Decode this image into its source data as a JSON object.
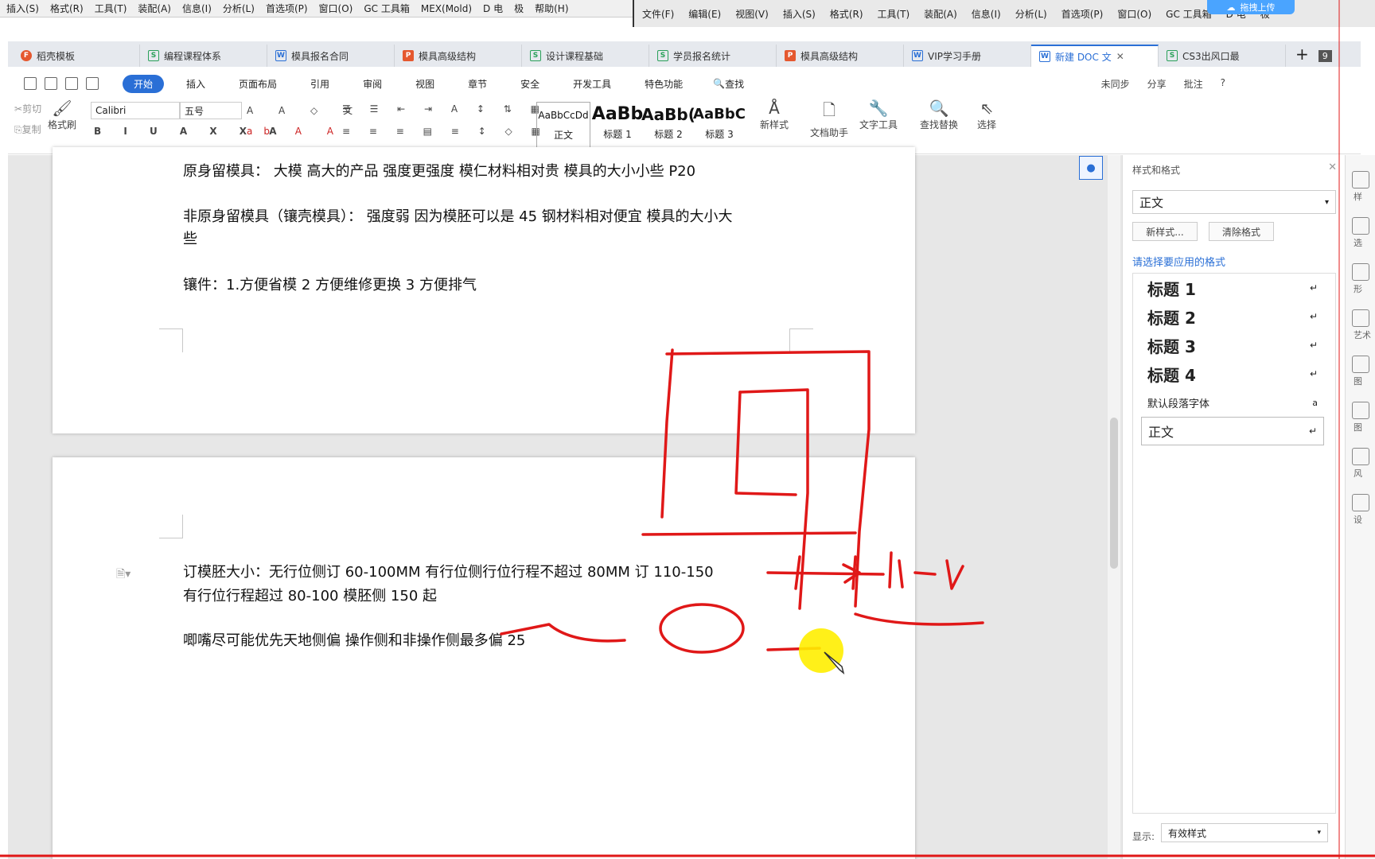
{
  "top_menu_left": [
    "插入(S)",
    "格式(R)",
    "工具(T)",
    "装配(A)",
    "信息(I)",
    "分析(L)",
    "首选项(P)",
    "窗口(O)",
    "GC 工具箱",
    "MEX(Mold)",
    "D 电",
    "极",
    "帮助(H)"
  ],
  "top_menu_right": [
    "文件(F)",
    "编辑(E)",
    "视图(V)",
    "插入(S)",
    "格式(R)",
    "工具(T)",
    "装配(A)",
    "信息(I)",
    "分析(L)",
    "首选项(P)",
    "窗口(O)",
    "GC 工具箱",
    "D 电",
    "极"
  ],
  "upload_label": "拖拽上传",
  "tabs": [
    {
      "label": "稻壳模板",
      "kind": "f"
    },
    {
      "label": "编程课程体系",
      "kind": "s"
    },
    {
      "label": "模具报名合同",
      "kind": "w"
    },
    {
      "label": "模具高级结构",
      "kind": "p"
    },
    {
      "label": "设计课程基础",
      "kind": "s"
    },
    {
      "label": "学员报名统计",
      "kind": "s"
    },
    {
      "label": "模具高级结构",
      "kind": "p"
    },
    {
      "label": "VIP学习手册",
      "kind": "w"
    },
    {
      "label": "新建 DOC 文",
      "kind": "w",
      "active": true
    },
    {
      "label": "CS3出风口最",
      "kind": "s"
    }
  ],
  "tab_count": "9",
  "ribbon_tabs": [
    "开始",
    "插入",
    "页面布局",
    "引用",
    "审阅",
    "视图",
    "章节",
    "安全",
    "开发工具",
    "特色功能"
  ],
  "search_label": "查找",
  "ribbon_right": {
    "sync": "未同步",
    "share": "分享",
    "comment": "批注",
    "help": "?"
  },
  "toolbar": {
    "cut": "剪切",
    "copy": "复制",
    "format_painter": "格式刷",
    "font_name": "Calibri",
    "font_size": "五号",
    "styles": [
      {
        "preview": "AaBbCcDd",
        "label": "正文"
      },
      {
        "preview": "AaBb",
        "label": "标题 1"
      },
      {
        "preview": "AaBb(",
        "label": "标题 2"
      },
      {
        "preview": "AaBbC",
        "label": "标题 3"
      }
    ],
    "new_style": "新样式",
    "doc_helper": "文档助手",
    "text_tools": "文字工具",
    "find_replace": "查找替换",
    "select": "选择"
  },
  "document": {
    "p1": "原身留模具：  大模  高大的产品  强度更强度    模仁材料相对贵    模具的大小小些  P20",
    "p2a": "非原身留模具（镶壳模具）：   强度弱    因为模胚可以是 45 钢材料相对便宜    模具的大小大",
    "p2b": "些",
    "p3": "镶件：1.方便省模  2 方便维修更换  3 方便排气",
    "p4a": "订模胚大小：无行位侧订 60-100MM      有行位侧行位行程不超过 80MM   订 110-150",
    "p4b": "    有行位行程超过 80-100 模胚侧 150 起",
    "p5": "唧嘴尽可能优先天地侧偏    操作侧和非操作侧最多偏 25"
  },
  "side_panel": {
    "title": "样式和格式",
    "current_style": "正文",
    "new_style_btn": "新样式...",
    "clear_btn": "清除格式",
    "choose_label": "请选择要应用的格式",
    "styles": [
      "标题  1",
      "标题  2",
      "标题  3",
      "标题  4"
    ],
    "default_font": "默认段落字体",
    "selected": "正文",
    "show_label": "显示:",
    "show_value": "有效样式"
  },
  "rail_labels": [
    "样",
    "选",
    "形",
    "艺术",
    "图",
    "图",
    "风",
    "设"
  ],
  "ink_color": "#e01818"
}
